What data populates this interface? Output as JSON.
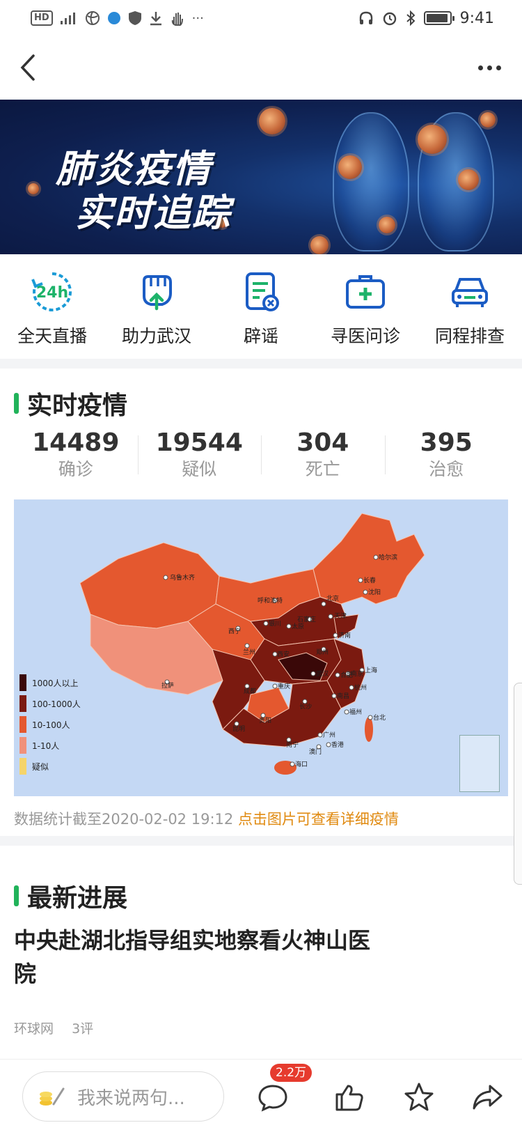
{
  "status_bar": {
    "network": "HD",
    "time": "9:41"
  },
  "banner": {
    "line1": "肺炎疫情",
    "line2": "实时追踪"
  },
  "quick_links": [
    {
      "label": "全天直播",
      "icon": "24h-clock-icon"
    },
    {
      "label": "助力武汉",
      "icon": "fist-icon"
    },
    {
      "label": "辟谣",
      "icon": "rumor-document-icon"
    },
    {
      "label": "寻医问诊",
      "icon": "medical-kit-icon"
    },
    {
      "label": "同程排查",
      "icon": "car-icon"
    }
  ],
  "realtime": {
    "title": "实时疫情",
    "stats": [
      {
        "value": "14489",
        "label": "确诊"
      },
      {
        "value": "19544",
        "label": "疑似"
      },
      {
        "value": "304",
        "label": "死亡"
      },
      {
        "value": "395",
        "label": "治愈"
      }
    ],
    "legend": [
      {
        "label": "1000人以上",
        "color": "#3a0808"
      },
      {
        "label": "100-1000人",
        "color": "#7b1a10"
      },
      {
        "label": "10-100人",
        "color": "#e4582f"
      },
      {
        "label": "1-10人",
        "color": "#f0917a"
      },
      {
        "label": "疑似",
        "color": "#f5d46a"
      }
    ],
    "cities": [
      "乌鲁木齐",
      "哈尔滨",
      "长春",
      "沈阳",
      "呼和浩特",
      "北京",
      "天津",
      "石家庄",
      "银川",
      "太原",
      "济南",
      "西宁",
      "兰州",
      "郑州",
      "西安",
      "合肥",
      "南京",
      "上海",
      "武汉",
      "拉萨",
      "成都",
      "重庆",
      "杭州",
      "南昌",
      "长沙",
      "福州",
      "台北",
      "贵阳",
      "昆明",
      "广州",
      "南宁",
      "澳门",
      "香港",
      "海口"
    ],
    "note": "数据统计截至2020-02-02 19:12",
    "note_link": "点击图片可查看详细疫情"
  },
  "latest": {
    "title": "最新进展",
    "headline": "中央赴湖北指导组实地察看火神山医院",
    "source": "环球网",
    "comments": "3评"
  },
  "bottom_bar": {
    "placeholder": "我来说两句...",
    "comment_count": "2.2万",
    "colors": {
      "accent_green": "#21b35a",
      "badge_red": "#e63b2e",
      "icon_blue": "#1b5cc4"
    }
  }
}
